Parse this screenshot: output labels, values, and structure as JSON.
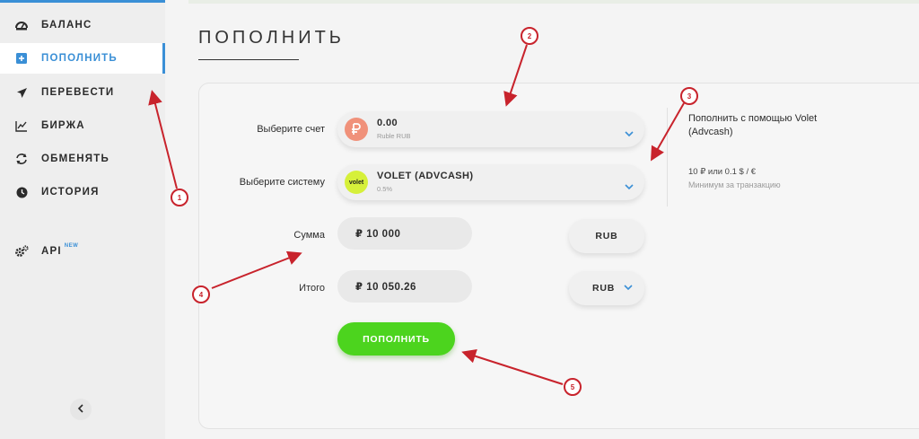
{
  "sidebar": {
    "items": [
      {
        "label": "БАЛАНС",
        "icon": "dashboard-gauge-icon"
      },
      {
        "label": "ПОПОЛНИТЬ",
        "icon": "plus-square-icon",
        "active": true
      },
      {
        "label": "ПЕРЕВЕСТИ",
        "icon": "paper-plane-icon"
      },
      {
        "label": "БИРЖА",
        "icon": "line-chart-icon"
      },
      {
        "label": "ОБМЕНЯТЬ",
        "icon": "exchange-arrows-icon"
      },
      {
        "label": "ИСТОРИЯ",
        "icon": "clock-icon"
      }
    ],
    "api": {
      "label": "API",
      "badge": "NEW",
      "icon": "gears-icon"
    },
    "collapse_icon": "chevron-left-icon"
  },
  "main": {
    "title": "ПОПОЛНИТЬ",
    "form": {
      "account_label": "Выберите счет",
      "account_value": "0.00",
      "account_sub": "Ruble RUB",
      "account_icon": "ruble-coin-icon",
      "system_label": "Выберите систему",
      "system_value": "VOLET (ADVCASH)",
      "system_sub": "0.5%",
      "system_logo": "volet",
      "amount_label": "Сумма",
      "amount_value": "₽ 10 000",
      "amount_currency": "RUB",
      "total_label": "Итого",
      "total_value": "₽ 10 050.26",
      "total_currency": "RUB",
      "submit_label": "ПОПОЛНИТЬ"
    },
    "info": {
      "title": "Пополнить с помощью Volet (Advcash)",
      "fee": "10 ₽ или 0.1 $ / €",
      "min_note": "Минимум за транзакцию"
    }
  },
  "annotations": [
    "1",
    "2",
    "3",
    "4",
    "5"
  ],
  "colors": {
    "accent": "#3a8fd6",
    "submit": "#4cd41e",
    "ruble_coin": "#f0917a",
    "volet_logo": "#d6f03a",
    "annotation": "#c8232c"
  }
}
